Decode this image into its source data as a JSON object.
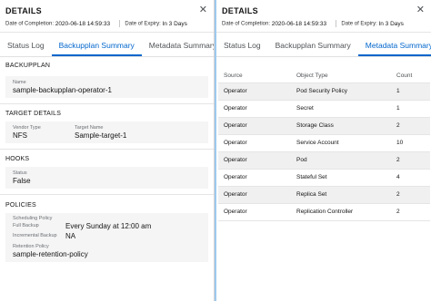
{
  "left": {
    "title": "DETAILS",
    "completion_label": "Date of Completion:",
    "completion_value": "2020-06-18 14:59:33",
    "expiry_label": "Date of Expiry:",
    "expiry_value": "In 3 Days",
    "tabs": [
      "Status Log",
      "Backupplan Summary",
      "Metadata Summary"
    ],
    "active_tab": "Backupplan Summary",
    "backupplan": {
      "heading": "BACKUPPLAN",
      "name_label": "Name",
      "name_value": "sample-backupplan-operator-1"
    },
    "target": {
      "heading": "TARGET DETAILS",
      "vendor_label": "Vendor Type",
      "vendor_value": "NFS",
      "target_label": "Target Name",
      "target_value": "Sample-target-1"
    },
    "hooks": {
      "heading": "HOOKS",
      "status_label": "Status",
      "status_value": "False"
    },
    "policies": {
      "heading": "POLICIES",
      "scheduling_label": "Scheduling Policy",
      "full_label": "Full Backup",
      "full_value": "Every Sunday at 12:00 am",
      "incremental_label": "Incremental Backup",
      "incremental_value": "NA",
      "retention_label": "Retention Policy",
      "retention_value": "sample-retention-policy"
    }
  },
  "right": {
    "title": "DETAILS",
    "completion_label": "Date of Completion:",
    "completion_value": "2020-06-18 14:59:33",
    "expiry_label": "Date of Expiry:",
    "expiry_value": "In 3 Days",
    "tabs": [
      "Status Log",
      "Backupplan Summary",
      "Metadata Summary"
    ],
    "active_tab": "Metadata Summary",
    "table": {
      "headers": [
        "Source",
        "Object Type",
        "Count"
      ],
      "rows": [
        [
          "Operator",
          "Pod Security Policy",
          "1"
        ],
        [
          "Operator",
          "Secret",
          "1"
        ],
        [
          "Operator",
          "Storage Class",
          "2"
        ],
        [
          "Operator",
          "Service Account",
          "10"
        ],
        [
          "Operator",
          "Pod",
          "2"
        ],
        [
          "Operator",
          "Stateful Set",
          "4"
        ],
        [
          "Operator",
          "Replica Set",
          "2"
        ],
        [
          "Operator",
          "Replication Controller",
          "2"
        ]
      ]
    }
  },
  "icons": {
    "close": "close-icon"
  },
  "colors": {
    "accent": "#0066cc",
    "active_border": "#9ec9ef",
    "card_bg": "#f5f5f5"
  }
}
